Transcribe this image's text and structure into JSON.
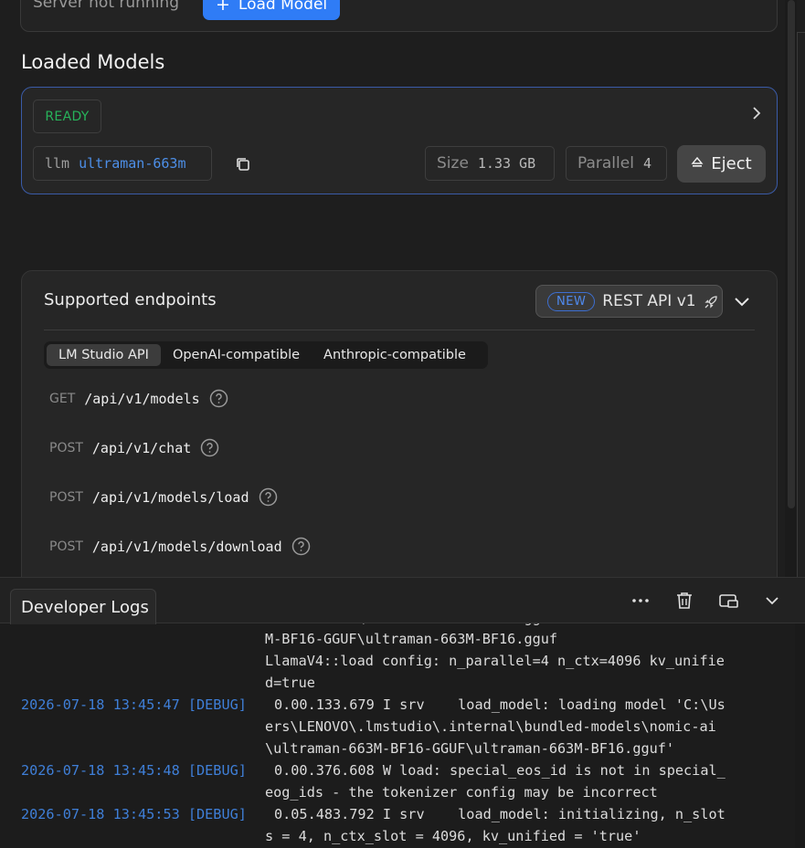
{
  "server": {
    "status_text": "Server not running",
    "load_model_label": "Load Model"
  },
  "loaded_models": {
    "title": "Loaded Models",
    "model": {
      "state": "READY",
      "prefix": "llm",
      "identifier": "ultraman-663m",
      "size_label": "Size",
      "size_value": "1.33 GB",
      "parallel_label": "Parallel",
      "parallel_value": "4",
      "eject_label": "Eject"
    }
  },
  "endpoints": {
    "title": "Supported endpoints",
    "new_badge": "NEW",
    "rest_api_label": "REST API v1",
    "tabs": [
      "LM Studio API",
      "OpenAI-compatible",
      "Anthropic-compatible"
    ],
    "active_tab": "LM Studio API",
    "items": [
      {
        "method": "GET",
        "path": "/api/v1/models"
      },
      {
        "method": "POST",
        "path": "/api/v1/chat"
      },
      {
        "method": "POST",
        "path": "/api/v1/models/load"
      },
      {
        "method": "POST",
        "path": "/api/v1/models/download"
      }
    ]
  },
  "developer_logs": {
    "tab_label": "Developer Logs",
    "lines": [
      {
        "ts": "",
        "text": "M-BF16-GGUF\\ultraman-663M-BF16.gguf"
      },
      {
        "ts": "",
        "text": "LlamaV4::load config: n_parallel=4 n_ctx=4096 kv_unifie"
      },
      {
        "ts": "",
        "text": "d=true"
      },
      {
        "ts": "2026-07-18 13:45:47 [DEBUG]",
        "text": "0.00.133.679 I srv    load_model: loading model 'C:\\Us"
      },
      {
        "ts": "",
        "text": "ers\\LENOVO\\.lmstudio\\.internal\\bundled-models\\nomic-ai"
      },
      {
        "ts": "",
        "text": "\\ultraman-663M-BF16-GGUF\\ultraman-663M-BF16.gguf'"
      },
      {
        "ts": "2026-07-18 13:45:48 [DEBUG]",
        "text": "0.00.376.608 W load: special_eos_id is not in special_"
      },
      {
        "ts": "",
        "text": "eog_ids - the tokenizer config may be incorrect"
      },
      {
        "ts": "2026-07-18 13:45:53 [DEBUG]",
        "text": "0.05.483.792 I srv    load_model: initializing, n_slot"
      },
      {
        "ts": "",
        "text": "s = 4, n_ctx_slot = 4096, kv_unified = 'true'"
      }
    ]
  },
  "icons": {
    "plus": "plus-icon",
    "chevron_right": "chevron-right-icon",
    "copy": "copy-icon",
    "eject": "eject-icon",
    "rocket": "rocket-icon",
    "chevron_down": "chevron-down-icon",
    "help": "question-circle-icon",
    "more": "more-horizontal-icon",
    "trash": "trash-icon",
    "window": "window-icon"
  },
  "colors": {
    "accent": "#2f7cf6",
    "ready": "#27b35a",
    "model_name": "#4d8fe8",
    "timestamp": "#3f7fd8"
  }
}
